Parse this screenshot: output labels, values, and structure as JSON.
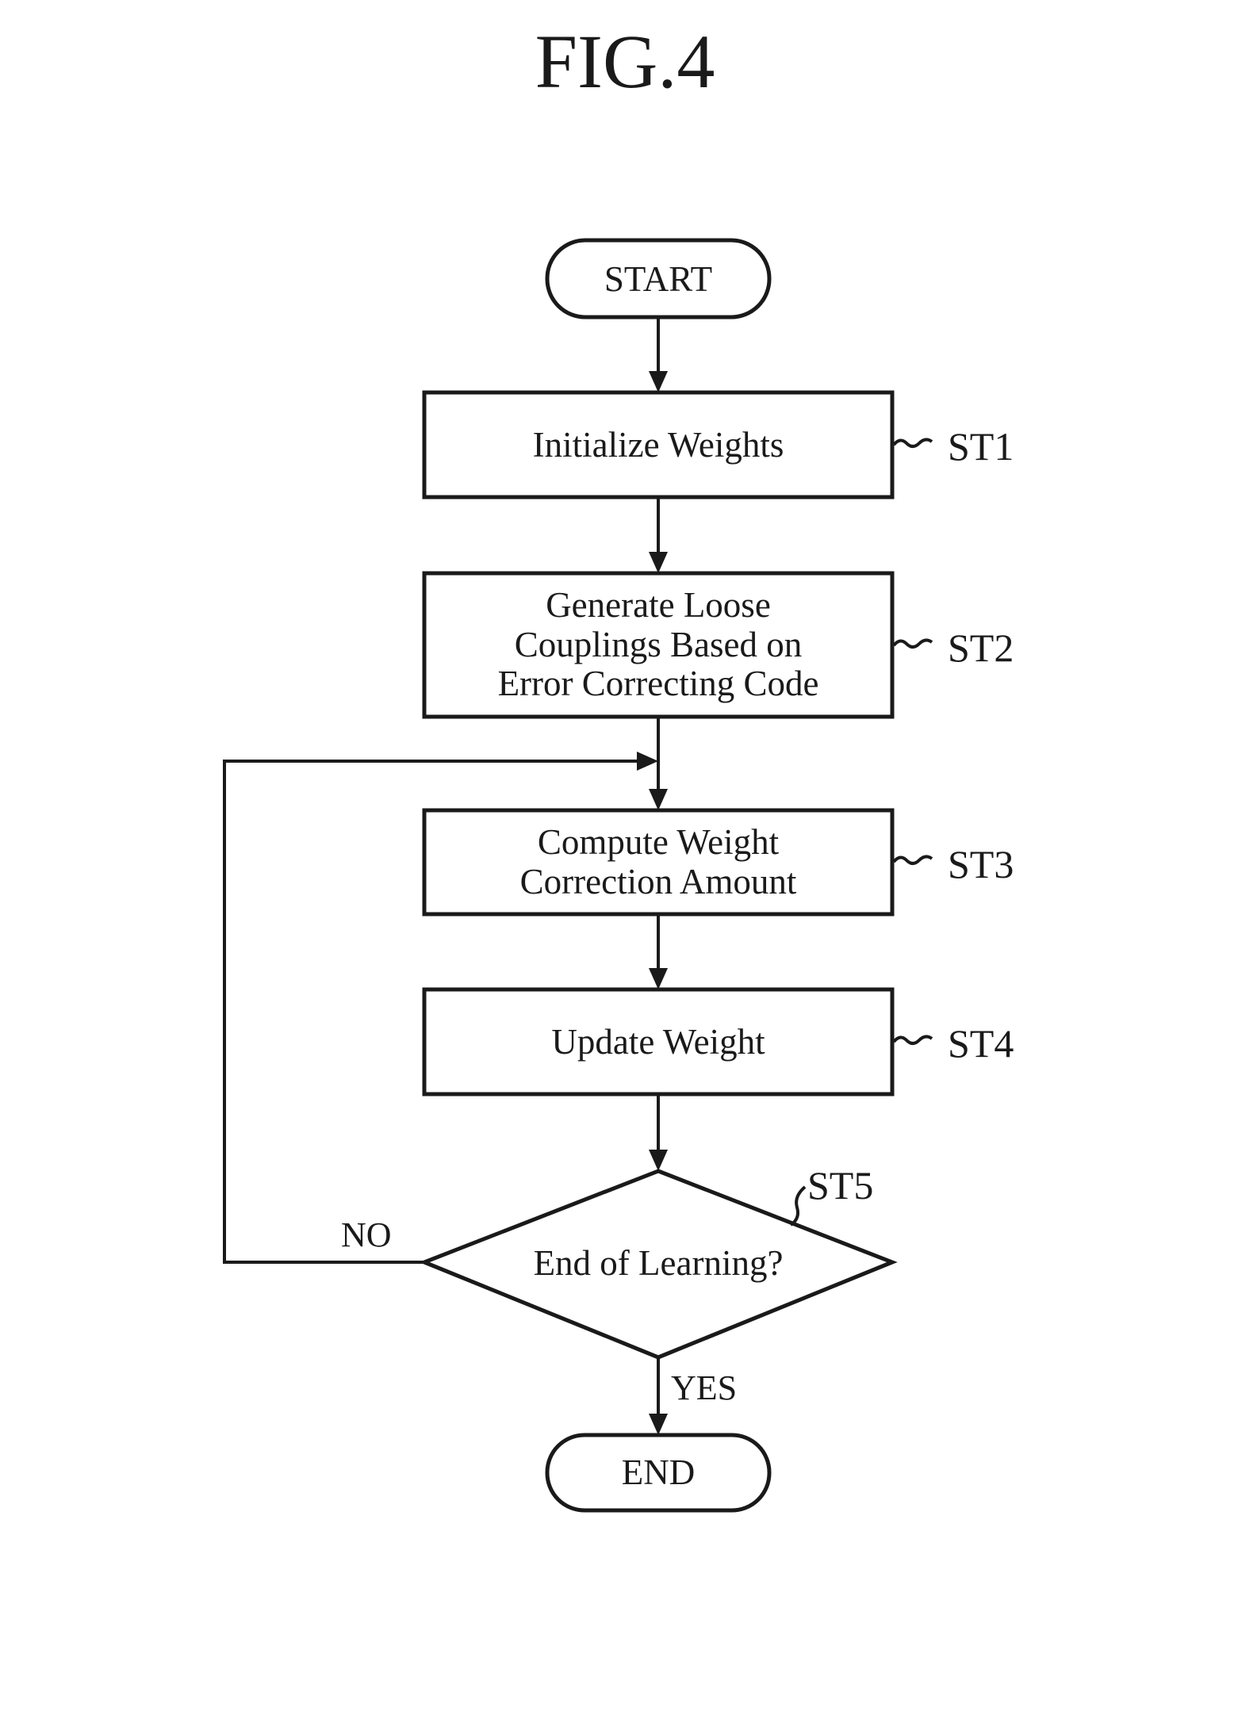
{
  "figure": {
    "title": "FIG.4"
  },
  "nodes": {
    "start": {
      "label": "START"
    },
    "st1": {
      "lines": [
        "Initialize Weights"
      ],
      "ref": "ST1"
    },
    "st2": {
      "lines": [
        "Generate Loose",
        "Couplings Based on",
        "Error Correcting Code"
      ],
      "ref": "ST2"
    },
    "st3": {
      "lines": [
        "Compute Weight",
        "Correction Amount"
      ],
      "ref": "ST3"
    },
    "st4": {
      "lines": [
        "Update Weight"
      ],
      "ref": "ST4"
    },
    "st5": {
      "lines": [
        "End of Learning?"
      ],
      "ref": "ST5"
    },
    "end": {
      "label": "END"
    }
  },
  "branches": {
    "no": "NO",
    "yes": "YES"
  }
}
